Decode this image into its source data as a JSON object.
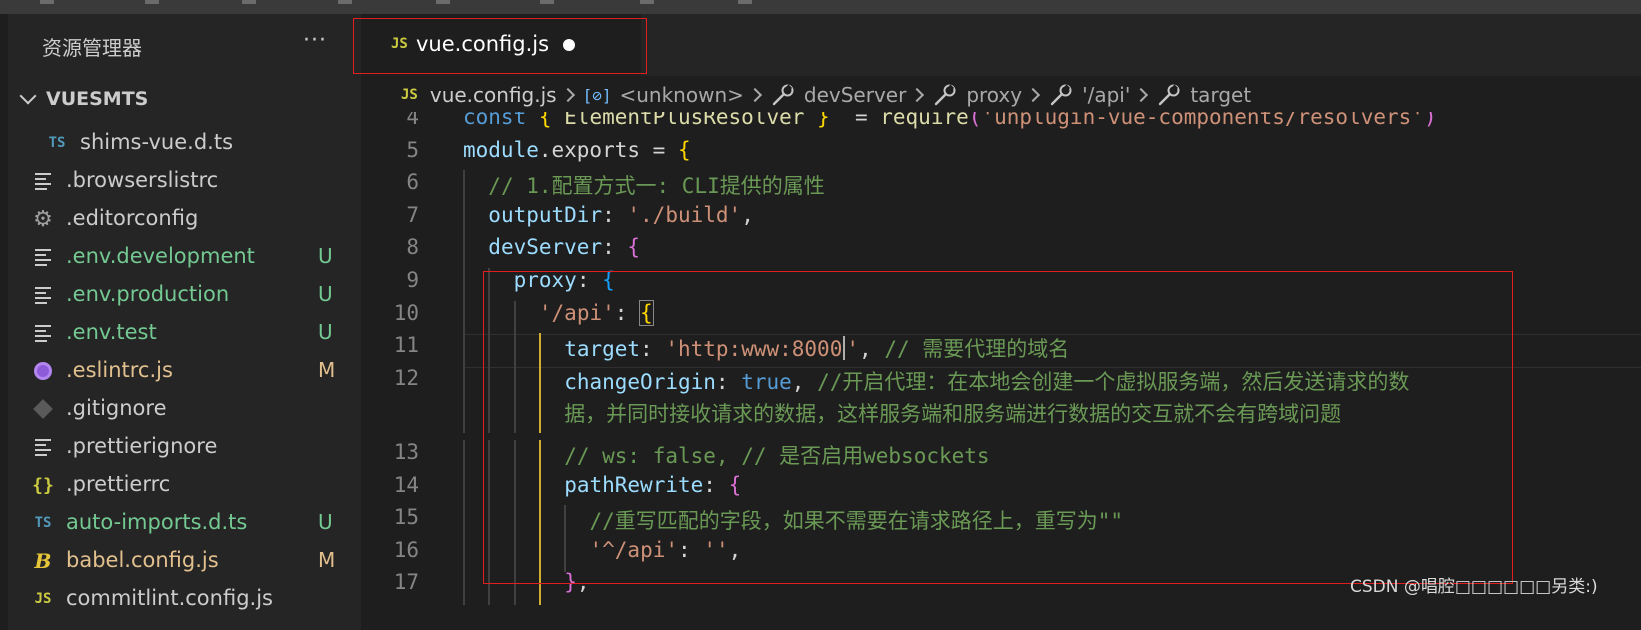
{
  "sidebar": {
    "title": "资源管理器",
    "more_label": "···",
    "section_label": "VUESMTS",
    "files": [
      {
        "name": "shims-vue.d.ts",
        "icon": "typescript-icon",
        "icon_text": "TS",
        "color": "#cccccc",
        "badge": ""
      },
      {
        "name": ".browserslistrc",
        "icon": "lines-file-icon",
        "icon_text": "",
        "color": "#cccccc",
        "badge": ""
      },
      {
        "name": ".editorconfig",
        "icon": "gear-icon",
        "icon_text": "⚙",
        "color": "#cccccc",
        "badge": ""
      },
      {
        "name": ".env.development",
        "icon": "lines-file-icon",
        "icon_text": "",
        "color": "#73c991",
        "badge": "U"
      },
      {
        "name": ".env.production",
        "icon": "lines-file-icon",
        "icon_text": "",
        "color": "#73c991",
        "badge": "U"
      },
      {
        "name": ".env.test",
        "icon": "lines-file-icon",
        "icon_text": "",
        "color": "#73c991",
        "badge": "U"
      },
      {
        "name": ".eslintrc.js",
        "icon": "eslint-icon",
        "icon_text": "",
        "color": "#e2c08d",
        "badge": "M"
      },
      {
        "name": ".gitignore",
        "icon": "git-icon",
        "icon_text": "",
        "color": "#cccccc",
        "badge": ""
      },
      {
        "name": ".prettierignore",
        "icon": "lines-file-icon",
        "icon_text": "",
        "color": "#cccccc",
        "badge": ""
      },
      {
        "name": ".prettierrc",
        "icon": "braces-icon",
        "icon_text": "{}",
        "color": "#cccccc",
        "badge": ""
      },
      {
        "name": "auto-imports.d.ts",
        "icon": "typescript-icon",
        "icon_text": "TS",
        "color": "#73c991",
        "badge": "U"
      },
      {
        "name": "babel.config.js",
        "icon": "babel-icon",
        "icon_text": "B",
        "color": "#e2c08d",
        "badge": "M"
      },
      {
        "name": "commitlint.config.js",
        "icon": "javascript-icon",
        "icon_text": "JS",
        "color": "#cccccc",
        "badge": ""
      }
    ]
  },
  "tab": {
    "icon_text": "JS",
    "label": "vue.config.js",
    "modified": true
  },
  "breadcrumb": [
    {
      "label": "vue.config.js",
      "icon": "javascript-icon",
      "icon_text": "JS"
    },
    {
      "label": "<unknown>",
      "icon": "symbol-object-icon",
      "icon_text": "[⊘]"
    },
    {
      "label": "devServer",
      "icon": "wrench-icon",
      "icon_text": ""
    },
    {
      "label": "proxy",
      "icon": "wrench-icon",
      "icon_text": ""
    },
    {
      "label": "'/api'",
      "icon": "wrench-icon",
      "icon_text": ""
    },
    {
      "label": "target",
      "icon": "wrench-icon",
      "icon_text": ""
    }
  ],
  "editor": {
    "current_line": 11,
    "lines": [
      {
        "num": "4",
        "indent": 0,
        "tokens": [
          [
            "k",
            "const "
          ],
          [
            "p1",
            "{ "
          ],
          [
            "f",
            "ElementPlusResolver"
          ],
          [
            "p1",
            " }"
          ],
          [
            "",
            "  = "
          ],
          [
            "f",
            "require"
          ],
          [
            "p2",
            "("
          ],
          [
            "s",
            "'unplugin-vue-components/resolvers'"
          ],
          [
            "p2",
            ")"
          ]
        ]
      },
      {
        "num": "5",
        "indent": 0,
        "tokens": [
          [
            "v",
            "module"
          ],
          [
            "",
            ".exports = "
          ],
          [
            "p1",
            "{"
          ]
        ]
      },
      {
        "num": "6",
        "indent": 1,
        "tokens": [
          [
            "c",
            "// 1.配置方式一: CLI提供的属性"
          ]
        ]
      },
      {
        "num": "7",
        "indent": 1,
        "tokens": [
          [
            "v",
            "outputDir"
          ],
          [
            "",
            ": "
          ],
          [
            "s",
            "'./build'"
          ],
          [
            "",
            ","
          ]
        ]
      },
      {
        "num": "8",
        "indent": 1,
        "tokens": [
          [
            "v",
            "devServer"
          ],
          [
            "",
            ": "
          ],
          [
            "p2",
            "{"
          ]
        ]
      },
      {
        "num": "9",
        "indent": 2,
        "tokens": [
          [
            "v",
            "proxy"
          ],
          [
            "",
            ": "
          ],
          [
            "p3",
            "{"
          ]
        ]
      },
      {
        "num": "10",
        "indent": 3,
        "tokens": [
          [
            "s",
            "'/api'"
          ],
          [
            "",
            ": "
          ],
          [
            "p1",
            "{"
          ]
        ]
      },
      {
        "num": "11",
        "indent": 4,
        "tokens": [
          [
            "v",
            "target"
          ],
          [
            "",
            ": "
          ],
          [
            "s",
            "'http:www:8000"
          ],
          [
            "caret",
            ""
          ],
          [
            "s",
            "'"
          ],
          [
            "",
            ", "
          ],
          [
            "c",
            "// 需要代理的域名"
          ]
        ]
      },
      {
        "num": "12",
        "indent": 4,
        "tokens": [
          [
            "v",
            "changeOrigin"
          ],
          [
            "",
            ": "
          ],
          [
            "k",
            "true"
          ],
          [
            "",
            ", "
          ],
          [
            "c",
            "//开启代理：在本地会创建一个虚拟服务端，然后发送请求的数"
          ]
        ]
      },
      {
        "num": "",
        "indent": 4,
        "tokens": [
          [
            "c",
            "据，并同时接收请求的数据，这样服务端和服务端进行数据的交互就不会有跨域问题"
          ]
        ]
      },
      {
        "num": "13",
        "indent": 4,
        "tokens": [
          [
            "c",
            "// ws: false, // 是否启用websockets"
          ]
        ]
      },
      {
        "num": "14",
        "indent": 4,
        "tokens": [
          [
            "v",
            "pathRewrite"
          ],
          [
            "",
            ": "
          ],
          [
            "p2",
            "{"
          ]
        ]
      },
      {
        "num": "15",
        "indent": 5,
        "tokens": [
          [
            "c",
            "//重写匹配的字段，如果不需要在请求路径上，重写为\"\""
          ]
        ]
      },
      {
        "num": "16",
        "indent": 5,
        "tokens": [
          [
            "s",
            "'^/api'"
          ],
          [
            "",
            ": "
          ],
          [
            "s",
            "''"
          ],
          [
            "",
            ","
          ]
        ]
      },
      {
        "num": "17",
        "indent": 4,
        "tokens": [
          [
            "p2",
            "}"
          ],
          [
            "",
            ","
          ]
        ]
      }
    ]
  },
  "watermark": "CSDN @唱腔□□□□□□另类:)",
  "colors": {
    "highlight_box": "#e02020",
    "untracked": "#73c991",
    "modified": "#e2c08d"
  }
}
